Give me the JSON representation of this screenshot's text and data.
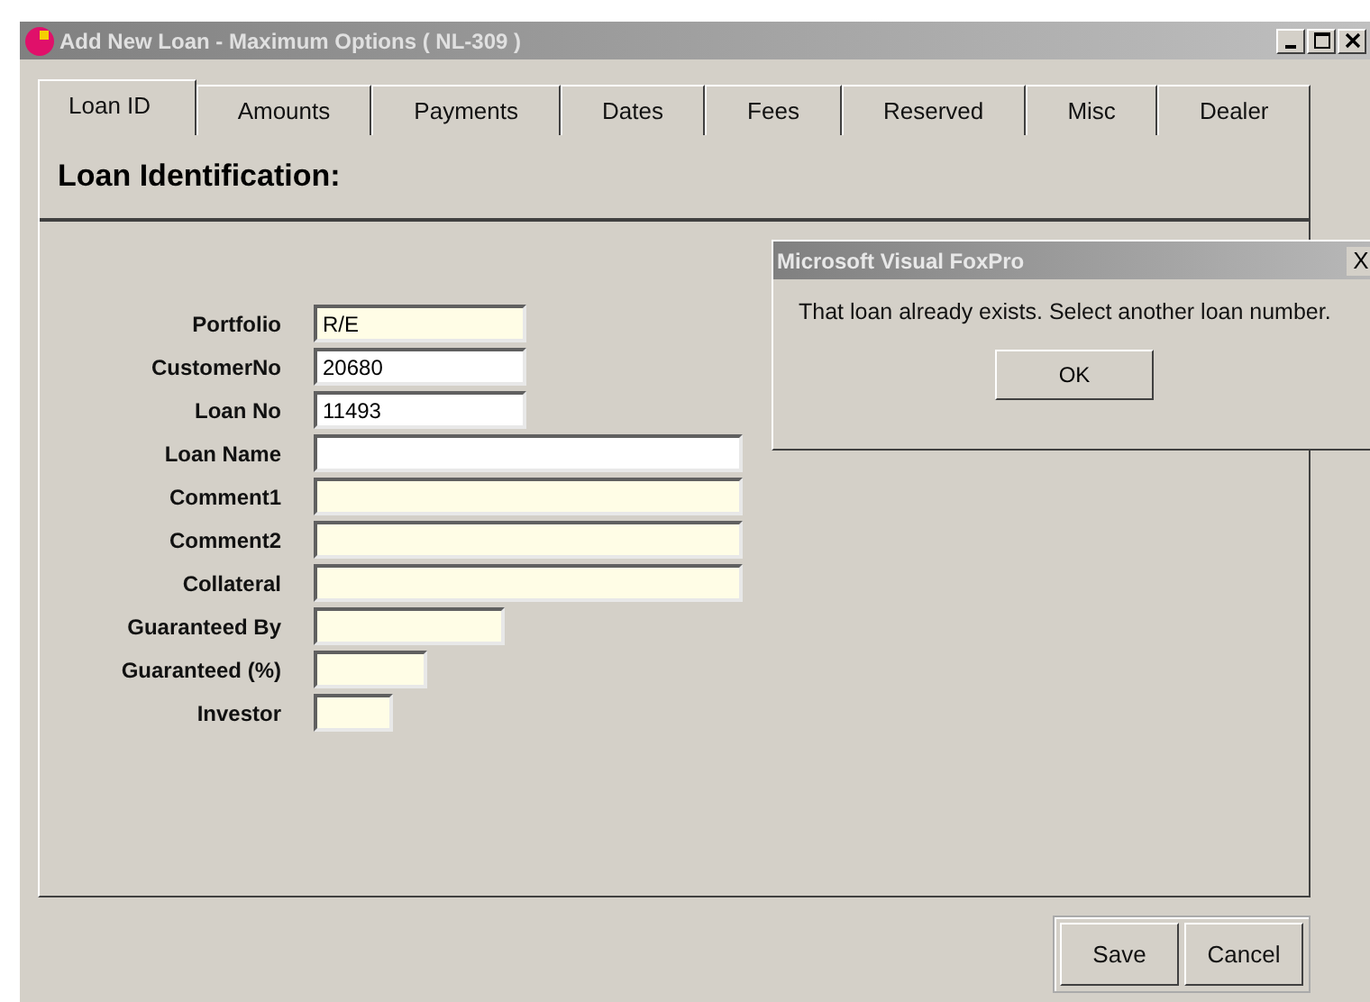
{
  "window": {
    "title": "Add New Loan - Maximum Options ( NL-309 )"
  },
  "tabs": [
    {
      "label": "Loan ID",
      "selected": true
    },
    {
      "label": "Amounts",
      "selected": false
    },
    {
      "label": "Payments",
      "selected": false
    },
    {
      "label": "Dates",
      "selected": false
    },
    {
      "label": "Fees",
      "selected": false
    },
    {
      "label": "Reserved",
      "selected": false
    },
    {
      "label": "Misc",
      "selected": false
    },
    {
      "label": "Dealer",
      "selected": false
    }
  ],
  "section_title": "Loan Identification:",
  "fields": [
    {
      "label": "Portfolio",
      "value": "R/E",
      "highlighted": true
    },
    {
      "label": "CustomerNo",
      "value": "20680",
      "highlighted": false
    },
    {
      "label": "Loan No",
      "value": "11493",
      "highlighted": false
    },
    {
      "label": "Loan Name",
      "highlighted": false
    },
    {
      "label": "Comment1",
      "highlighted": true
    },
    {
      "label": "Comment2",
      "highlighted": true
    },
    {
      "label": "Collateral",
      "highlighted": true
    },
    {
      "label": "Guaranteed By",
      "highlighted": true
    },
    {
      "label": "Guaranteed (%)",
      "highlighted": true
    },
    {
      "label": "Investor",
      "highlighted": true
    }
  ],
  "buttons": [
    "Save",
    "Cancel"
  ],
  "dialog": {
    "title": "Microsoft Visual FoxPro",
    "close": "X",
    "message": "That loan already exists. Select another loan number.",
    "button": "OK"
  }
}
